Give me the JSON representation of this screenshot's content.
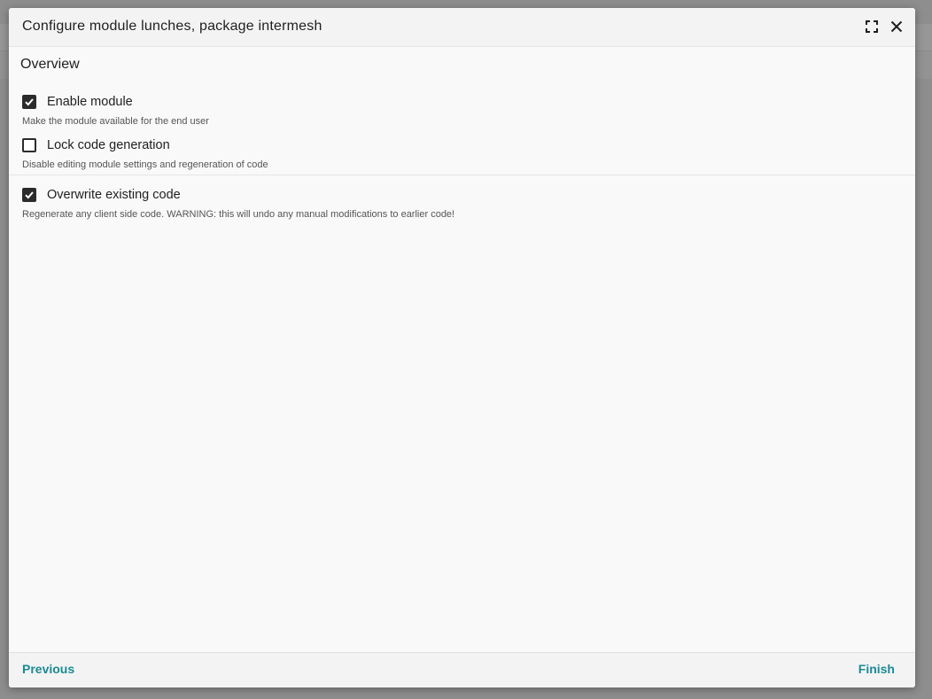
{
  "dialog": {
    "title": "Configure module lunches, package intermesh",
    "maximize_icon": "maximize-icon",
    "close_icon": "close-icon"
  },
  "section": {
    "title": "Overview"
  },
  "options": [
    {
      "label": "Enable module",
      "hint": "Make the module available for the end user",
      "checked": true
    },
    {
      "label": "Lock code generation",
      "hint": "Disable editing module settings and regeneration of code",
      "checked": false
    },
    {
      "label": "Overwrite existing code",
      "hint": "Regenerate any client side code. WARNING: this will undo any manual modifications to earlier code!",
      "checked": true
    }
  ],
  "footer": {
    "previous_label": "Previous",
    "finish_label": "Finish"
  },
  "colors": {
    "accent": "#1a8a96",
    "checkbox": "#2b2b2b",
    "overlay": "#8e8e8e"
  }
}
